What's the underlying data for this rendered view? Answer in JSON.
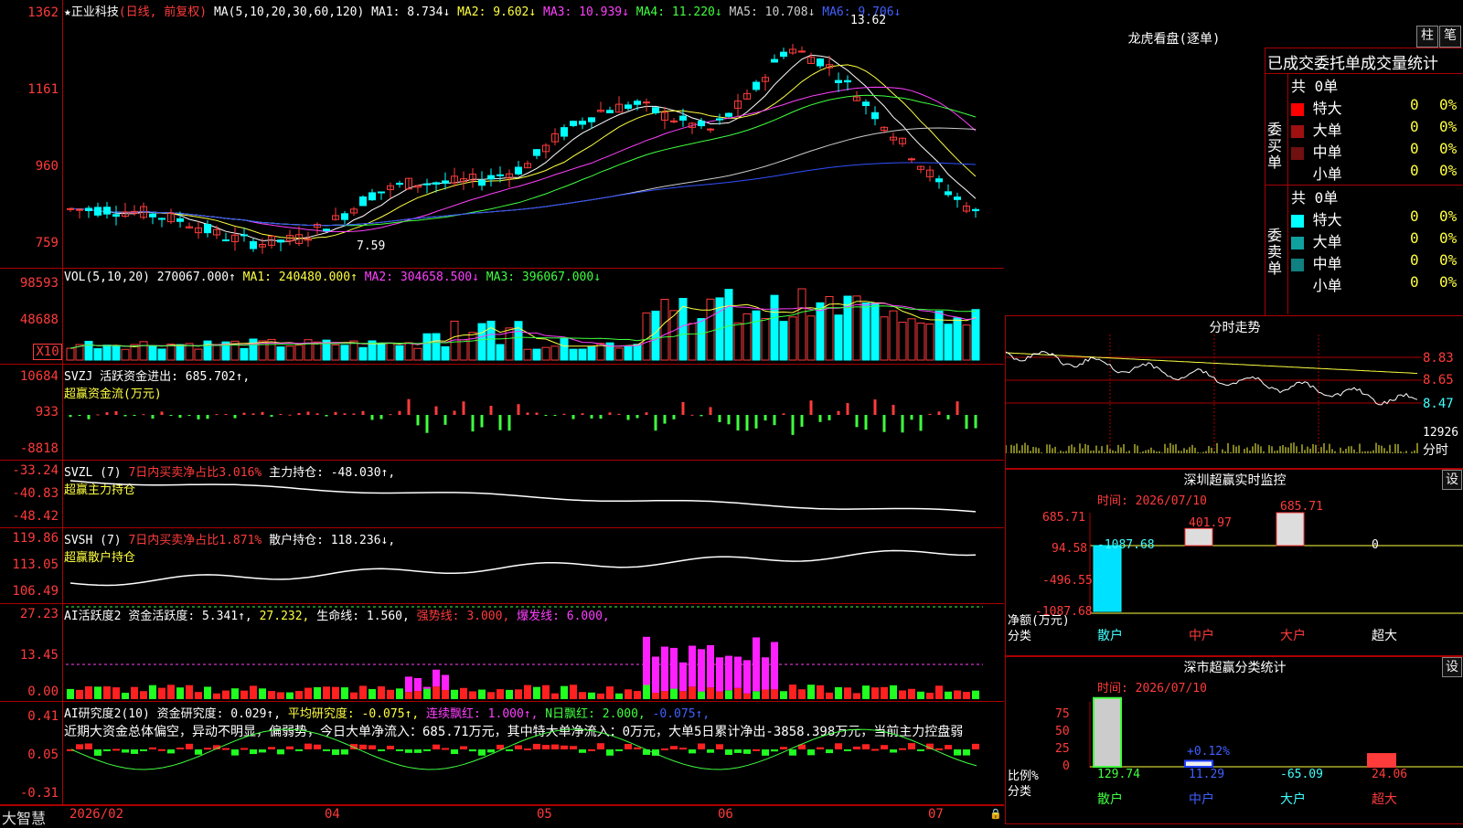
{
  "kline": {
    "title": "★正业科技",
    "mode": "(日线, 前复权)",
    "ma_label": "MA(5,10,20,30,60,120)",
    "ma1": "MA1: 8.734↓",
    "ma2": "MA2: 9.602↓",
    "ma3": "MA3: 10.939↓",
    "ma4": "MA4: 11.220↓",
    "ma5": "MA5: 10.708↓",
    "ma6": "MA6: 9.706↓",
    "high_note": "13.62",
    "low_note": "7.59",
    "y_ticks": [
      "1362",
      "1161",
      "960",
      "759"
    ]
  },
  "vol": {
    "label": "VOL(5,10,20)",
    "val": "270067.000↑",
    "ma1": "MA1: 240480.000↑",
    "ma2": "MA2: 304658.500↓",
    "ma3": "MA3: 396067.000↓",
    "y_ticks": [
      "98593",
      "48688",
      "X10"
    ]
  },
  "svzj": {
    "label": "SVZJ",
    "line1": "活跃资金进出: 685.702↑,",
    "line2": "超赢资金流(万元)",
    "y_ticks": [
      "10684",
      "933",
      "-8818"
    ]
  },
  "svzl": {
    "label": "SVZL (7)",
    "ratio": "7日内买卖净占比3.016%",
    "hold": "主力持仓: -48.030↑,",
    "line2": "超赢主力持仓",
    "y_ticks": [
      "-33.24",
      "-40.83",
      "-48.42"
    ]
  },
  "svsh": {
    "label": "SVSH (7)",
    "ratio": "7日内买卖净占比1.871%",
    "hold": "散户持仓: 118.236↓,",
    "line2": "超赢散户持仓",
    "y_ticks": [
      "119.86",
      "113.05",
      "106.49"
    ]
  },
  "ai1": {
    "label": "AI活跃度2",
    "activity": "资金活跃度: 5.341↑,",
    "val2": "27.232,",
    "life": "生命线: 1.560,",
    "strong": "强势线: 3.000,",
    "burst": "爆发线: 6.000,",
    "y_ticks": [
      "27.23",
      "13.45",
      "0.00"
    ]
  },
  "ai2": {
    "label": "AI研究度2(10)",
    "research": "资金研究度: 0.029↑,",
    "avg": "平均研究度: -0.075↑,",
    "cont": "连续飘红: 1.000↑,",
    "nday": "N日飘红: 2.000,",
    "last": "-0.075↑,",
    "comment": "近期大资金总体偏空，异动不明显，偏弱势，今日大单净流入：685.71万元，其中特大单净流入：0万元，大单5日累计净出-3858.398万元，当前主力控盘弱",
    "y_ticks": [
      "0.41",
      "0.05",
      "-0.31"
    ]
  },
  "bottom_axis": {
    "brand": "大智慧",
    "dates": [
      "2026/02",
      "04",
      "05",
      "06",
      "07"
    ]
  },
  "dragon": {
    "title": "龙虎看盘(逐单)",
    "btn_bar": "柱",
    "btn_pen": "笔",
    "subtitle": "已成交委托单成交量统计",
    "buy_side": "委买单",
    "sell_side": "委卖单",
    "buy_total": "共 0单",
    "sell_total": "共 0单",
    "buy_rows": [
      {
        "label": "特大",
        "count": "0",
        "pct": "0%",
        "color": "#ff0000"
      },
      {
        "label": "大单",
        "count": "0",
        "pct": "0%",
        "color": "#a01010"
      },
      {
        "label": "中单",
        "count": "0",
        "pct": "0%",
        "color": "#701010"
      },
      {
        "label": "小单",
        "count": "0",
        "pct": "0%",
        "color": ""
      }
    ],
    "sell_rows": [
      {
        "label": "特大",
        "count": "0",
        "pct": "0%",
        "color": "#00ffff"
      },
      {
        "label": "大单",
        "count": "0",
        "pct": "0%",
        "color": "#10a0a0"
      },
      {
        "label": "中单",
        "count": "0",
        "pct": "0%",
        "color": "#108080"
      },
      {
        "label": "小单",
        "count": "0",
        "pct": "0%",
        "color": ""
      }
    ]
  },
  "intraday": {
    "title": "分时走势",
    "prices": [
      "8.83",
      "8.65",
      "8.47"
    ],
    "vol": "12926",
    "vol_label": "分时"
  },
  "sz_monitor": {
    "title": "深圳超赢实时监控",
    "btn": "设",
    "date": "时间: 2026/07/10",
    "y_ticks": [
      "685.71",
      "94.58",
      "-496.55",
      "-1087.68"
    ],
    "y_unit": "净额(万元)",
    "cat_label": "分类",
    "categories": [
      "散户",
      "中户",
      "大户",
      "超大"
    ],
    "values": [
      -1087.68,
      401.97,
      685.71,
      0
    ],
    "value_labels": [
      "-1087.68",
      "401.97",
      "685.71",
      "0"
    ]
  },
  "sz_class": {
    "title": "深市超赢分类统计",
    "btn": "设",
    "date": "时间: 2026/07/10",
    "y_ticks": [
      "75",
      "50",
      "25",
      "0"
    ],
    "y_unit": "比例%",
    "cat_label": "分类",
    "categories": [
      "散户",
      "中户",
      "大户",
      "超大"
    ],
    "values": [
      129.74,
      11.29,
      -65.09,
      24.06
    ],
    "value_labels": [
      "129.74",
      "11.29",
      "-65.09",
      "24.06"
    ],
    "note": "+0.12%"
  },
  "colors": {
    "up": "#ff3b3b",
    "down": "#00ffff",
    "axis": "#aa0000"
  }
}
